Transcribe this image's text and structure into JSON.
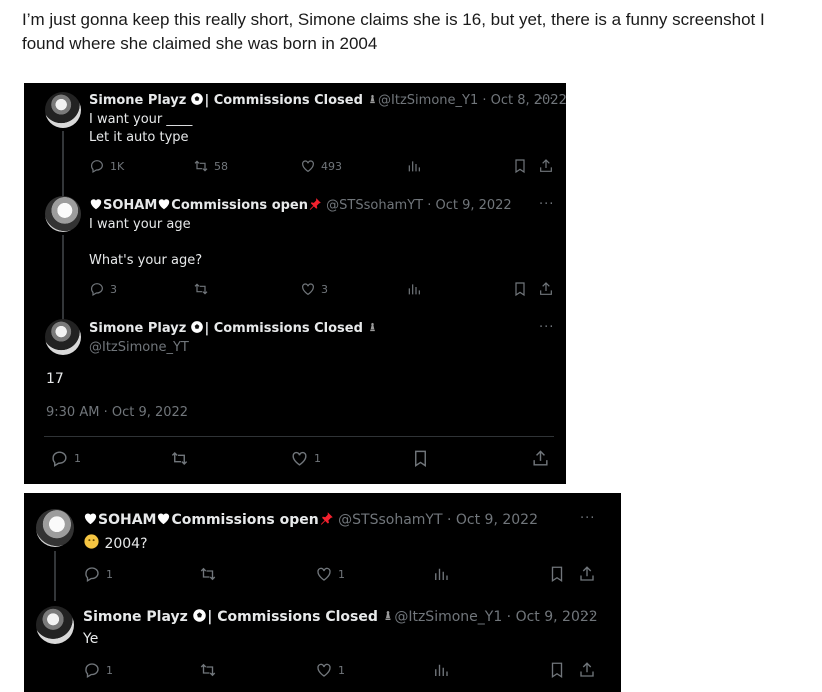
{
  "intro_text": "I’m just gonna keep this really short, Simone claims she is 16, but yet, there is a funny screenshot I found where she claimed she was born in 2004",
  "screenshot1": {
    "tweet1": {
      "name": "Simone Playz",
      "name_suffix": "| Commissions Closed",
      "handle_date": "@ItzSimone_Y1 · Oct 8, 2022",
      "text_line1": "I want your ____",
      "text_line2": "Let it auto type",
      "replies": "1K",
      "retweets": "58",
      "likes": "493"
    },
    "tweet2": {
      "name_prefix": "SOHAM",
      "name_suffix": "Commissions open",
      "handle_date": "@STSsohamYT · Oct 9, 2022",
      "text_line1": "I want your age",
      "text_line2": "What's your age?",
      "replies": "3",
      "retweets": "",
      "likes": "3"
    },
    "tweet3": {
      "name": "Simone Playz",
      "name_suffix": "| Commissions Closed",
      "handle": "@ItzSimone_YT",
      "text": "17",
      "timestamp": "9:30 AM · Oct 9, 2022",
      "replies": "1",
      "likes": "1"
    }
  },
  "screenshot2": {
    "tweet1": {
      "name_prefix": "SOHAM",
      "name_suffix": "Commissions open",
      "handle_date": "@STSsohamYT · Oct 9, 2022",
      "text": "2004?",
      "replies": "1",
      "likes": "1"
    },
    "tweet2": {
      "name": "Simone Playz",
      "name_suffix": "| Commissions Closed",
      "handle_date": "@ItzSimone_Y1 · Oct 9, 2022",
      "text": "Ye",
      "replies": "1",
      "likes": "1"
    }
  },
  "more_label": "···",
  "colors": {
    "background": "#000000",
    "text": "#e7e9ea",
    "muted": "#71767b",
    "pin": "#f4212e",
    "emoji": "#f5c542"
  }
}
